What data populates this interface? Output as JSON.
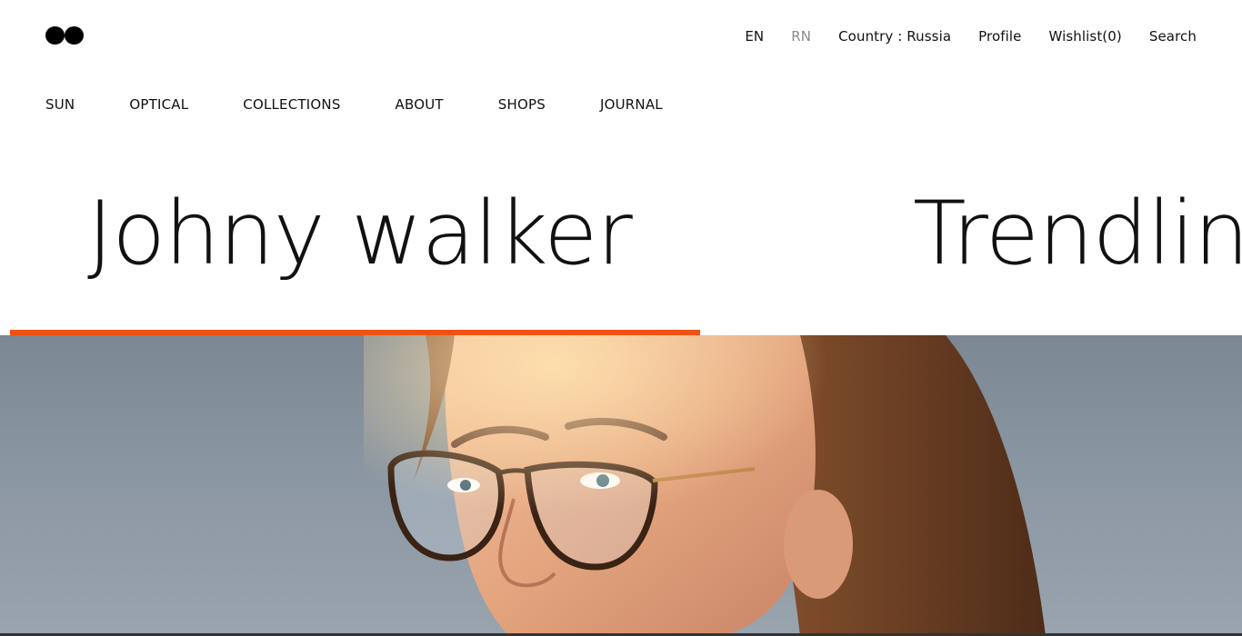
{
  "utility_nav": {
    "lang_en": "EN",
    "lang_rn": "RN",
    "country": "Country : Russia",
    "profile": "Profile",
    "wishlist": "Wishlist(0)",
    "search": "Search"
  },
  "main_nav": [
    "SUN",
    "OPTICAL",
    "COLLECTIONS",
    "ABOUT",
    "SHOPS",
    "JOURNAL"
  ],
  "slider": {
    "slides": [
      "Johny walker",
      "Trendline"
    ],
    "progress_fraction": 0.56
  },
  "colors": {
    "accent": "#f05214",
    "text": "#111111",
    "muted": "#8a8a8a",
    "background": "#ffffff"
  },
  "hero": {
    "image": "woman-wearing-glasses-photo"
  }
}
